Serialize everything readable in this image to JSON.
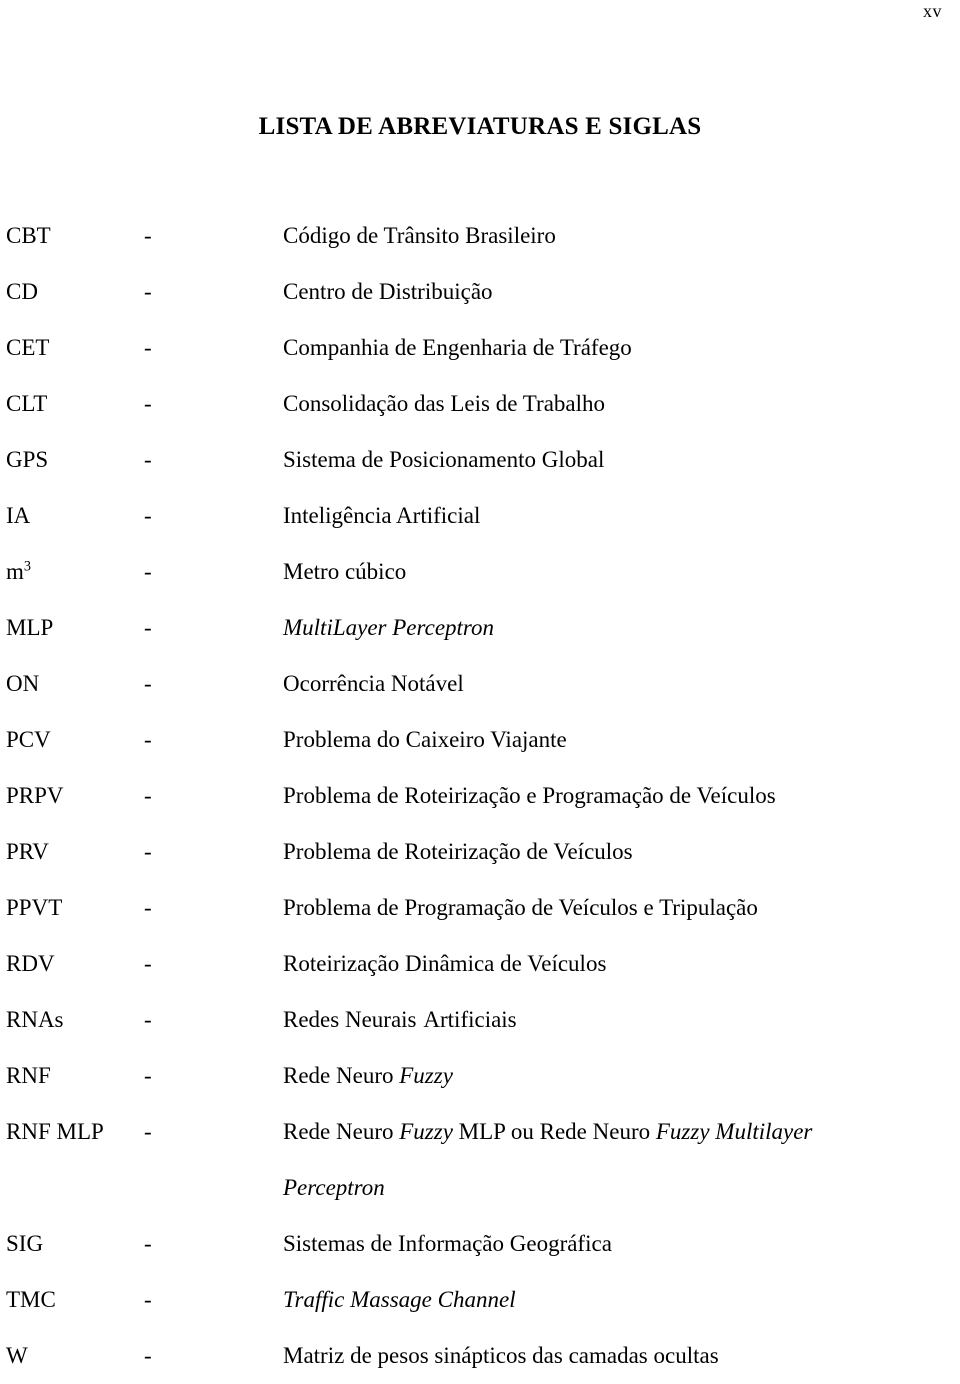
{
  "page": {
    "number": "xv",
    "title": "LISTA DE ABREVIATURAS E SIGLAS",
    "separator": "-"
  },
  "abbreviations": [
    {
      "term": "CBT",
      "definition": "Código de Trânsito Brasileiro"
    },
    {
      "term": "CD",
      "definition": "Centro de Distribuição"
    },
    {
      "term": "CET",
      "definition": "Companhia de Engenharia de Tráfego"
    },
    {
      "term": "CLT",
      "definition": "Consolidação das Leis de Trabalho"
    },
    {
      "term": "GPS",
      "definition": "Sistema de Posicionamento Global"
    },
    {
      "term": "IA",
      "definition": "Inteligência Artificial"
    },
    {
      "term": "m³",
      "definition": "Metro cúbico"
    },
    {
      "term": "MLP",
      "definition": "MultiLayer Perceptron"
    },
    {
      "term": "ON",
      "definition": "Ocorrência Notável"
    },
    {
      "term": "PCV",
      "definition": "Problema do Caixeiro Viajante"
    },
    {
      "term": "PRPV",
      "definition": "Problema de Roteirização e Programação de Veículos"
    },
    {
      "term": "PRV",
      "definition": "Problema de Roteirização de Veículos"
    },
    {
      "term": "PPVT",
      "definition": "Problema de Programação de Veículos e Tripulação"
    },
    {
      "term": "RDV",
      "definition": "Roteirização Dinâmica de Veículos"
    },
    {
      "term": "RNAs",
      "definition": "Redes Neurais  Artificiais"
    },
    {
      "term": "RNF",
      "definition": "Rede Neuro Fuzzy"
    },
    {
      "term": "RNF MLP",
      "definition": "Rede Neuro Fuzzy MLP ou Rede Neuro Fuzzy Multilayer Perceptron"
    },
    {
      "term": "SIG",
      "definition": "Sistemas de Informação Geográfica"
    },
    {
      "term": "TMC",
      "definition": "Traffic Massage Channel"
    },
    {
      "term": "W",
      "definition": "Matriz de pesos sinápticos das camadas ocultas"
    }
  ]
}
